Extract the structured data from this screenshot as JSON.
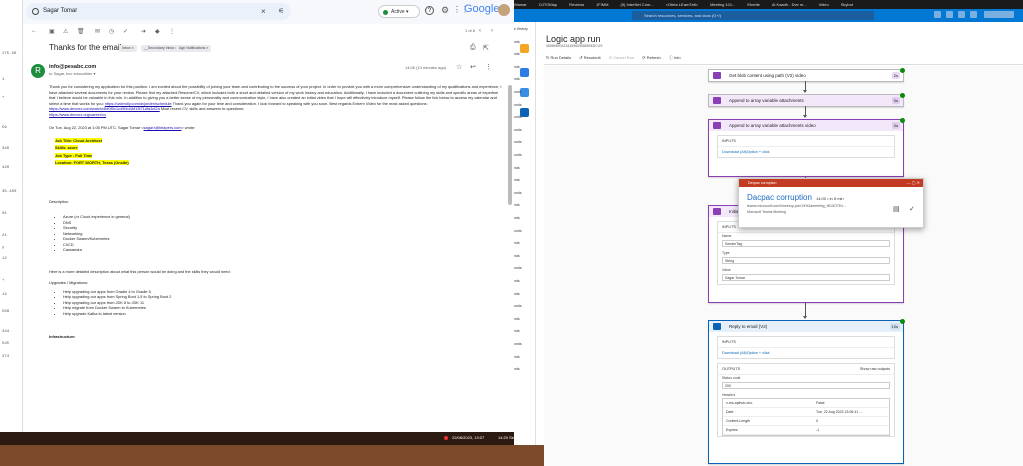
{
  "gutter": [
    "175.58",
    "1",
    "+",
    "59",
    "340",
    "420",
    "35.450",
    "01",
    "21",
    "y",
    "12",
    "+",
    "14",
    "508",
    "344",
    "545",
    "374"
  ],
  "gmail": {
    "search_value": "Sagar Tomar",
    "status": "Active",
    "logo": "Google",
    "pager": "1 of 8",
    "subject": "Thanks for the email",
    "labels": [
      "Inbox ×",
      "__Secondary Inbox ×",
      "Agn Notifications ×"
    ],
    "sender": "info@pesabc.com",
    "recipient": "to Sagar, bcc edouathier ▾",
    "date": "14:06 (14 minutes ago)",
    "avatar_letter": "R",
    "body": {
      "intro": "Thank you for considering my application for this position. I am excited about the possibility of joining your team and contributing to the success of your project. In order to provide you with a more comprehensive understanding of my qualifications and experience, I have attached several documents for your review. Please find my attached Resume/CV, which includes both a short and detailed version of my work history and education. Additionally, I have included a document outlining my skills and specific areas of expertise that I believe would be valuable in this role. In addition to giving you a better sense of my personality and communication style, I have also created an initial video that I hope will effectively introduce myself. Please follow the link below to access my calendar and select a time that works for you:",
      "calendar_link": "https://calendly.com/dvjorden/schedule",
      "intro_tail": " Thank you again for your time and consideration. I look forward to speaking with you soon. Best regards Exbern Video for the most asked questions:",
      "video_link": "https://www.devoxx.com/watch/4bf0f0c1c49f4d4bf13f71dfa3cf2a",
      "intro_tail2": " Most recent CV, skills and answers to questions:",
      "cv_link": "https://www.devoxx.org/career/cv",
      "quote_head": "On Tue, Aug 22, 2023 at 1:05 PM UTC, Sagar Tomar <",
      "quote_email": "sagar.t@bitapers.com",
      "quote_tail": "> wrote:",
      "job_title": "Job Title: Cloud Architect",
      "skills": "Skills: azure",
      "job_type": "Job Type : Full Time",
      "location": "Location: FORT WORTH, Texas (Onsite)",
      "description_label": "Description",
      "skills_list": [
        "Azure (or Cloud experience in general)",
        "DNS",
        "Security",
        "Networking",
        "Docker Swarm/Kubernetes",
        "CI/CD",
        "Cassandra"
      ],
      "detail_line": "Here is a more detailed description about what this person would be doing and the skills they would need:",
      "upgrades_label": "Upgrades / Migrations:",
      "upgrades_list": [
        "Help upgrading our apps from Gradle 4 to Gradle 5",
        "Help upgrading our apps from Spring Boot 1.5 to Spring Boot 2",
        "Help upgrading our apps from JDK 8 to JDK 11",
        "Help migrate from Docker Swarm to Kubernetes",
        "Help upgrade Kafka to latest version"
      ],
      "infra_label": "Infrastructure:"
    }
  },
  "taskbar": {
    "datetime": "22/08/2023, 13:07",
    "seconds": "14:20 Seconds"
  },
  "azure": {
    "tabs": [
      "Wamar",
      "OJTOMap",
      "Reviews",
      "JFIMM",
      "(5) InterNet Com...",
      "<Ofeta LEarnTalt>",
      "Meeting 101...",
      "Eberlie",
      "Ai Kaadh - Dve m...",
      "Video",
      "Skybot"
    ],
    "search_placeholder": "Search resources, services, and docs (G+/)",
    "list_items": [
      "e History",
      "nds",
      "nds",
      "nds",
      "nds",
      "onds",
      "onds",
      "onds",
      "onds",
      "onds",
      "onds",
      "nds",
      "nds",
      "onds",
      "nds",
      "nds",
      "onds",
      "nds",
      "nds",
      "onds",
      "nds",
      "nds",
      "onds",
      "nds",
      "nds",
      "onds",
      "nds",
      "nds"
    ],
    "title": "Logic app run",
    "run_id": "08585690413415960558880E8CUS",
    "commands": [
      "↻ Run Details",
      "↺ Resubmit",
      "⊘ Cancel Run",
      "⟳ Refresh",
      "ⓘ Info"
    ],
    "steps": [
      {
        "name": "Get blob content using path (V2) video",
        "time": "2s"
      },
      {
        "name": "Append to array variable attachments",
        "time": "0s"
      },
      {
        "name": "Append to array variable attachments video",
        "time": "0s"
      },
      {
        "name": "Initialize",
        "time": ""
      },
      {
        "name": "Reply to email (V2)",
        "time": "10s"
      }
    ],
    "inputs_label": "INPUTS",
    "download_label": "Download (All)Option + click",
    "name_label": "Name",
    "name_value": "SenderTag",
    "type_label": "Type",
    "type_value": "String",
    "value_label": "Value",
    "value_value": "Sagar Tomar",
    "outputs_label": "OUTPUTS",
    "show_raw": "Show raw outputs",
    "status_code_label": "Status code",
    "status_code": "200",
    "headers_label": "Headers",
    "headers": [
      {
        "k": "x-ms-apihub-obo",
        "v": "False"
      },
      {
        "k": "Date",
        "v": "Tue, 22 Aug 2023 13:06:41 ..."
      },
      {
        "k": "Content-Length",
        "v": "0"
      },
      {
        "k": "Expires",
        "v": "-1"
      }
    ]
  },
  "toast": {
    "app": "Devpac corruption",
    "name": "Dacpac corruption",
    "time": "14:00 • in 8 min",
    "url": "teams.microsoft.com/l/meetup-join/19%3ameeting_NDJiOTEx...",
    "location": "Microsoft Teams Meeting"
  }
}
